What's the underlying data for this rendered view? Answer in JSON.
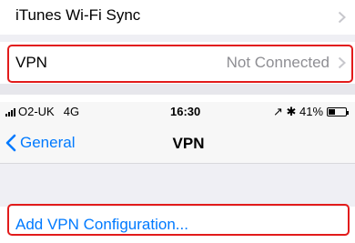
{
  "settings": {
    "itunes_row": {
      "label": "iTunes Wi-Fi Sync",
      "icon": "chevron-right-icon"
    },
    "vpn_row": {
      "label": "VPN",
      "value": "Not Connected",
      "icon": "chevron-right-icon"
    }
  },
  "status_bar": {
    "carrier": "O2-UK",
    "network": "4G",
    "time": "16:30",
    "indicators": "↗ ✱ 41%",
    "battery_level": 0.41
  },
  "nav": {
    "back_label": "General",
    "title": "VPN"
  },
  "vpn_page": {
    "add_label": "Add VPN Configuration..."
  },
  "colors": {
    "ios_blue": "#007aff",
    "highlight_red": "#e21b1b",
    "group_bg": "#efeff4",
    "secondary_text": "#8e8e93"
  }
}
